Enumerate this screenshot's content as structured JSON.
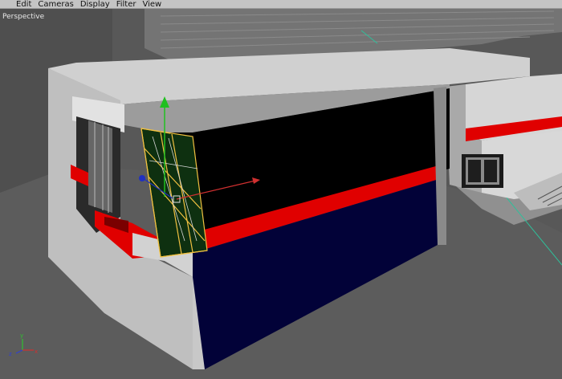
{
  "menu": {
    "items": [
      {
        "label": "Edit"
      },
      {
        "label": "Cameras"
      },
      {
        "label": "Display"
      },
      {
        "label": "Filter"
      },
      {
        "label": "View"
      }
    ]
  },
  "viewport": {
    "label": "Perspective"
  },
  "axis_indicator": {
    "x_label": "x",
    "y_label": "y",
    "z_label": "z"
  },
  "colors": {
    "menubar": "#c4c4c4",
    "wall_light": "#d2d2d2",
    "stripe_red": "#e00000",
    "panel_navy": "#020238",
    "selected_wireframe": "#f0c040",
    "gizmo_x": "#d03030",
    "gizmo_y": "#20c020",
    "gizmo_z": "#2030c0"
  }
}
